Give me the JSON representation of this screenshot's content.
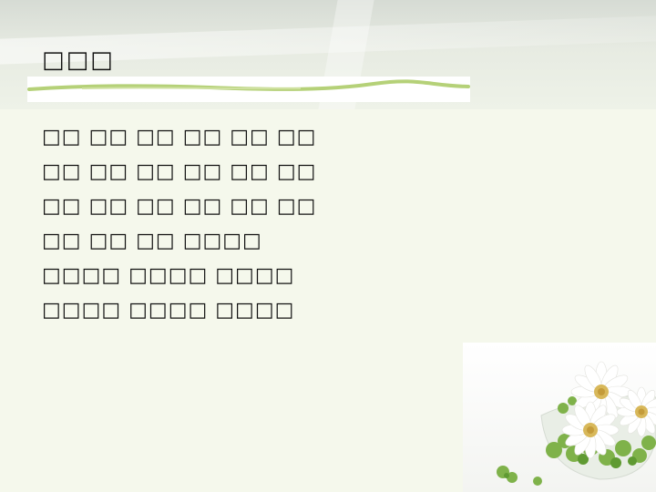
{
  "slide": {
    "title": "□□□",
    "rows": [
      "□□ □□ □□ □□ □□ □□",
      "□□ □□ □□ □□ □□ □□",
      "□□ □□ □□ □□ □□ □□",
      "□□ □□ □□ □□□□",
      "□□□□ □□□□ □□□□",
      "□□□□ □□□□ □□□□"
    ]
  },
  "decor": {
    "underline_color": "#b5d178",
    "image": "daisy-bowl-icon"
  }
}
